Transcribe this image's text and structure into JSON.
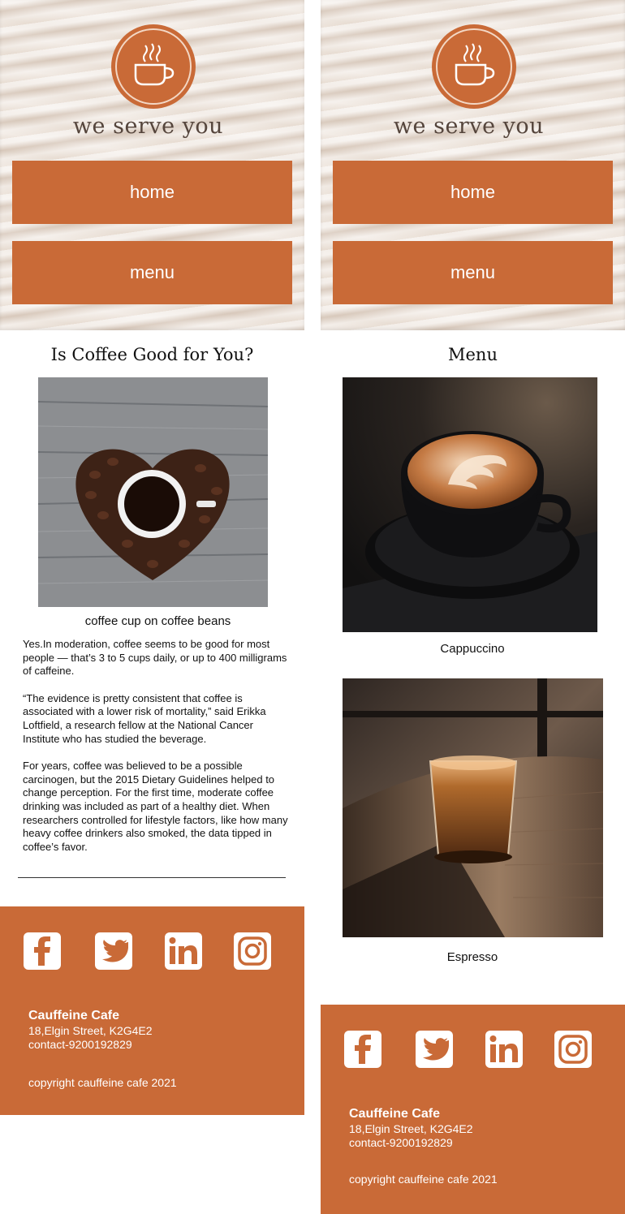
{
  "brand": {
    "tagline": "we serve you",
    "accent": "#c96a37",
    "logo_icon": "coffee-cup-icon"
  },
  "nav": {
    "home_label": "home",
    "menu_label": "menu"
  },
  "blog_page": {
    "title": "Is Coffee Good for You?",
    "image_caption": "coffee cup on coffee beans",
    "paragraphs": [
      "Yes.In moderation, coffee seems to be good for most people — that’s 3 to 5 cups daily, or up to 400 milligrams of caffeine.",
      "“The evidence is pretty consistent that coffee is associated with a lower risk of mortality,” said Erikka Loftfield, a research fellow at the National Cancer Institute who has studied the beverage.",
      "For years, coffee was believed to be a possible carcinogen, but the 2015 Dietary Guidelines helped to change perception. For the first time, moderate coffee drinking was included as part of a healthy diet. When researchers controlled for lifestyle factors, like how many heavy coffee drinkers also smoked, the data tipped in coffee’s favor."
    ]
  },
  "menu_page": {
    "title": "Menu",
    "items": [
      {
        "name": "Cappuccino"
      },
      {
        "name": "Espresso"
      }
    ]
  },
  "footer": {
    "social": [
      "facebook-icon",
      "twitter-icon",
      "linkedin-icon",
      "instagram-icon"
    ],
    "cafe_name": "Cauffeine Cafe",
    "address": "18,Elgin Street, K2G4E2",
    "contact": "contact-9200192829",
    "copyright": "copyright cauffeine cafe 2021"
  }
}
